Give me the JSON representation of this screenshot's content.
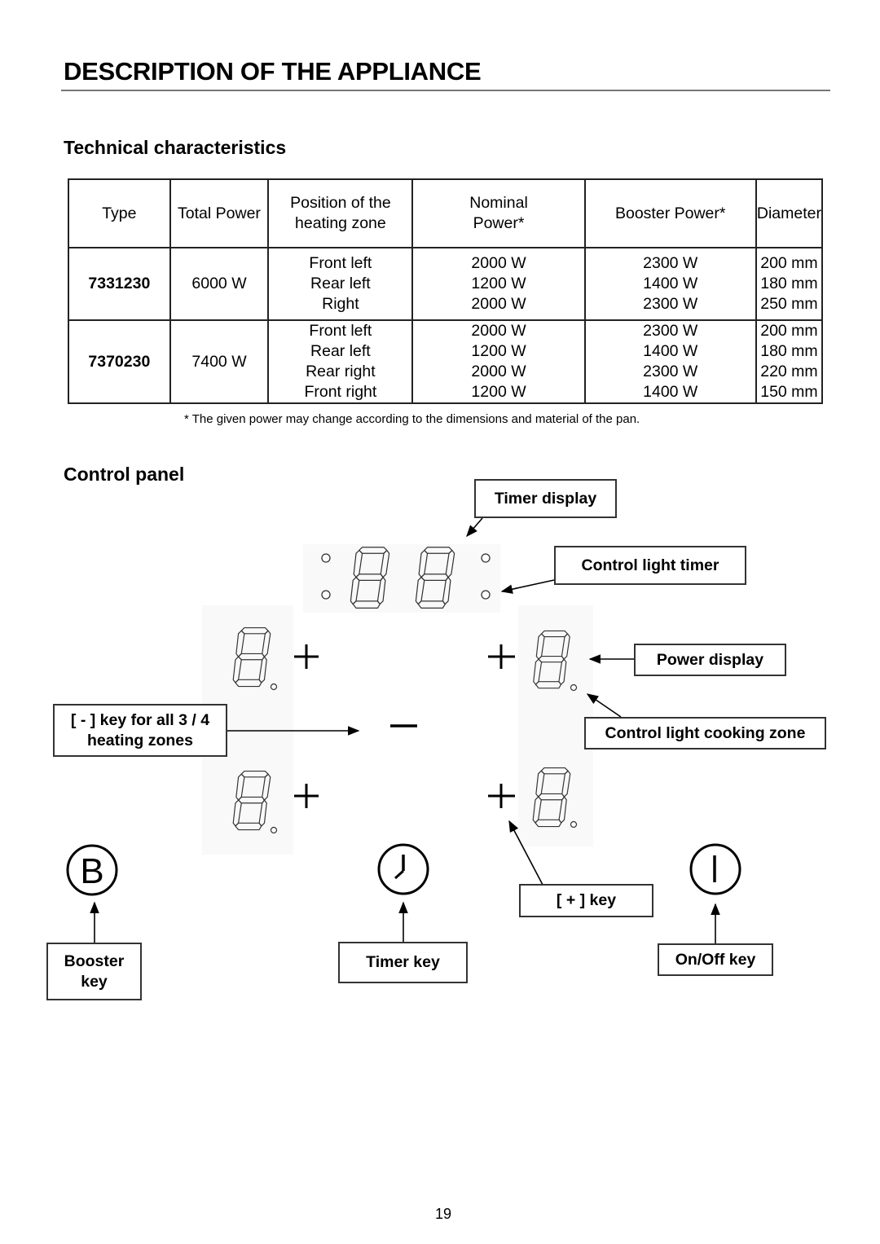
{
  "page": {
    "title": "DESCRIPTION OF THE APPLIANCE",
    "page_number": "19"
  },
  "technical": {
    "heading": "Technical characteristics",
    "columns": [
      "Type",
      "Total Power",
      "Position of the heating zone",
      "Nominal Power*",
      "Booster Power*",
      "Diameter"
    ],
    "models": [
      {
        "type": "7331230",
        "total_power": "6000 W",
        "zones": [
          {
            "position": "Front left",
            "nominal": "2000 W",
            "booster": "2300 W",
            "diameter": "200 mm"
          },
          {
            "position": "Rear left",
            "nominal": "1200 W",
            "booster": "1400 W",
            "diameter": "180 mm"
          },
          {
            "position": "Right",
            "nominal": "2000 W",
            "booster": "2300 W",
            "diameter": "250 mm"
          }
        ]
      },
      {
        "type": "7370230",
        "total_power": "7400 W",
        "zones": [
          {
            "position": "Front left",
            "nominal": "2000 W",
            "booster": "2300 W",
            "diameter": "200 mm"
          },
          {
            "position": "Rear left",
            "nominal": "1200 W",
            "booster": "1400 W",
            "diameter": "180 mm"
          },
          {
            "position": "Rear right",
            "nominal": "2000 W",
            "booster": "2300 W",
            "diameter": "220 mm"
          },
          {
            "position": "Front right",
            "nominal": "1200 W",
            "booster": "1400 W",
            "diameter": "150 mm"
          }
        ]
      }
    ],
    "footnote": "* The given power may change according to the dimensions and material of the pan."
  },
  "control_panel": {
    "heading": "Control panel",
    "labels": {
      "timer_display": "Timer display",
      "control_light_timer": "Control light timer",
      "power_display": "Power display",
      "control_light_cooking_zone": "Control light cooking zone",
      "minus_key": "[ - ] key for all 3 / 4 heating zones",
      "plus_key": "[ + ] key",
      "booster_key": "Booster key",
      "timer_key": "Timer key",
      "onoff_key": "On/Off key"
    },
    "symbols": {
      "plus": "+",
      "minus": "−",
      "booster": "B"
    }
  }
}
